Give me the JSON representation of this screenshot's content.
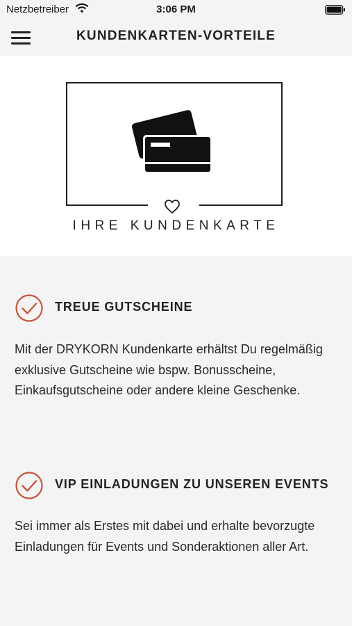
{
  "status": {
    "carrier": "Netzbetreiber",
    "time": "3:06 PM"
  },
  "nav": {
    "title": "KUNDENKARTEN-VORTEILE"
  },
  "hero": {
    "caption": "IHRE KUNDENKARTE"
  },
  "benefits": [
    {
      "title": "TREUE GUTSCHEINE",
      "text": "Mit der DRYKORN Kundenkarte erhältst Du regelmäßig exklusive Gutscheine wie bspw. Bonusscheine, Einkaufsgutscheine oder andere kleine Geschenke."
    },
    {
      "title": "VIP EINLADUNGEN ZU UNSEREN EVENTS",
      "text": "Sei immer als Erstes mit dabei und erhalte bevorzugte Einladungen für Events und Sonderaktionen aller Art."
    }
  ],
  "colors": {
    "accent": "#c8553d"
  }
}
